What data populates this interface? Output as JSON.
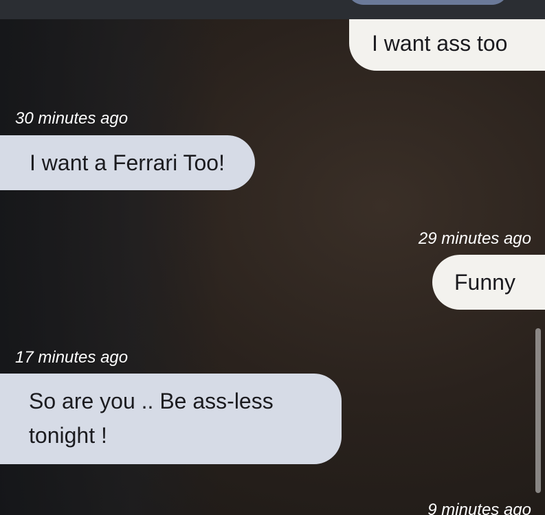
{
  "messages": [
    {
      "direction": "outgoing",
      "text": "I want ass too"
    },
    {
      "direction": "incoming",
      "time": "30 minutes ago",
      "text": "I want a Ferrari Too!"
    },
    {
      "direction": "outgoing",
      "time": "29 minutes ago",
      "text": "Funny"
    },
    {
      "direction": "incoming",
      "time": "17 minutes ago",
      "text": "So are you .. Be ass-less tonight !"
    },
    {
      "direction": "outgoing",
      "time": "9 minutes ago"
    }
  ],
  "colors": {
    "outgoing_bubble": "#f3f2ee",
    "incoming_bubble": "#d6dbe6",
    "timestamp_text": "#ffffff",
    "message_text": "#1b1b1f"
  }
}
